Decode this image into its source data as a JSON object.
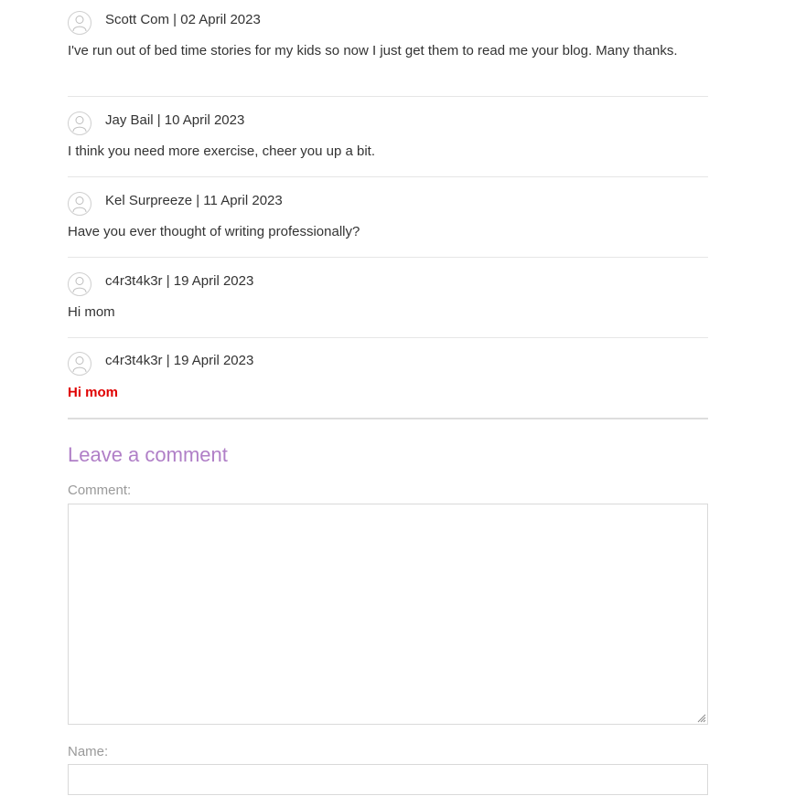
{
  "comments": [
    {
      "author": "Scott Com",
      "date": "02 April 2023",
      "meta": "Scott Com | 02 April 2023",
      "text": "I've run out of bed time stories for my kids so now I just get them to read me your blog. Many thanks."
    },
    {
      "author": "Jay Bail",
      "date": "10 April 2023",
      "meta": "Jay Bail | 10 April 2023",
      "text": "I think you need more exercise, cheer you up a bit."
    },
    {
      "author": "Kel Surpreeze",
      "date": "11 April 2023",
      "meta": "Kel Surpreeze | 11 April 2023",
      "text": "Have you ever thought of writing professionally?"
    },
    {
      "author": "c4r3t4k3r",
      "date": "19 April 2023",
      "meta": "c4r3t4k3r | 19 April 2023",
      "text": "Hi mom"
    },
    {
      "author": "c4r3t4k3r",
      "date": "19 April 2023",
      "meta": "c4r3t4k3r | 19 April 2023",
      "text": "Hi mom",
      "highlight_color": "#e00000"
    }
  ],
  "leave_comment": {
    "heading": "Leave a comment",
    "comment_label": "Comment:",
    "comment_value": "",
    "name_label": "Name:",
    "name_value": ""
  },
  "colors": {
    "heading": "#b07fc7",
    "label": "#9a9a9a",
    "highlight": "#e00000"
  },
  "icons": {
    "avatar": "user-avatar-icon",
    "resize": "resize-grip-icon"
  }
}
